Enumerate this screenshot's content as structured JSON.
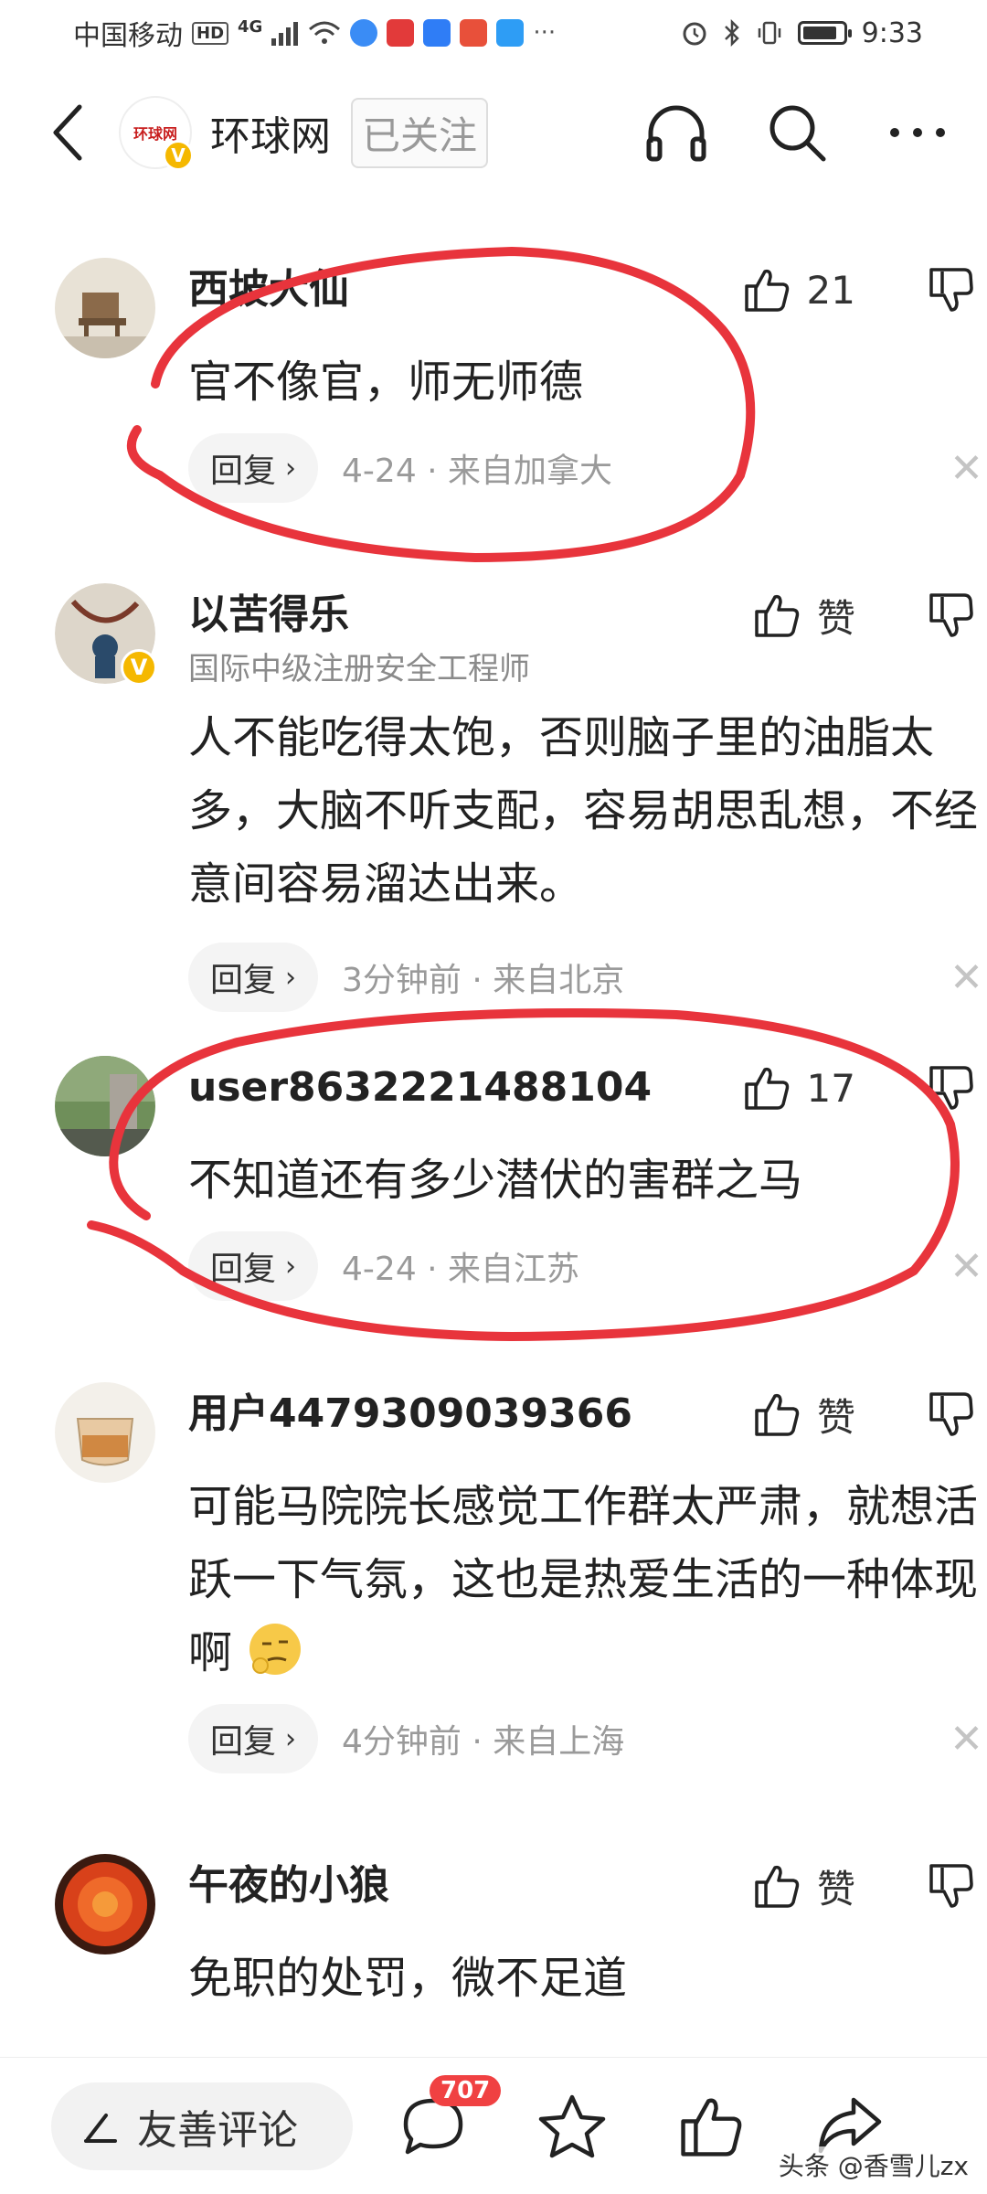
{
  "status_bar": {
    "carrier": "中国移动",
    "hd": "HD",
    "network": "4G",
    "time": "9:33",
    "battery_fraction": 0.85
  },
  "header": {
    "source_name": "环球网",
    "logo_text": "环球网",
    "verified_badge": "V",
    "follow_label": "已关注",
    "icons": [
      "back-icon",
      "headphones-icon",
      "search-icon",
      "more-icon"
    ]
  },
  "comments": [
    {
      "name": "西坡大仙",
      "subtitle": "",
      "text": "官不像官，师无师德",
      "like_label": "21",
      "reply_label": "回复",
      "meta": "4-24 · 来自加拿大"
    },
    {
      "name": "以苦得乐",
      "subtitle": "国际中级注册安全工程师",
      "text": "人不能吃得太饱，否则脑子里的油脂太多，大脑不听支配，容易胡思乱想，不经意间容易溜达出来。",
      "like_label": "赞",
      "reply_label": "回复",
      "meta": "3分钟前 · 来自北京"
    },
    {
      "name": "user8632221488104",
      "subtitle": "",
      "text": "不知道还有多少潜伏的害群之马",
      "like_label": "17",
      "reply_label": "回复",
      "meta": "4-24 · 来自江苏"
    },
    {
      "name": "用户4479309039366",
      "subtitle": "",
      "text": "可能马院院长感觉工作群太严肃，就想活跃一下气氛，这也是热爱生活的一种体现啊",
      "like_label": "赞",
      "reply_label": "回复",
      "meta": "4分钟前 · 来自上海"
    },
    {
      "name": "午夜的小狼",
      "subtitle": "",
      "text": "免职的处罚，微不足道",
      "like_label": "赞",
      "reply_label": "",
      "meta": ""
    }
  ],
  "bottom_bar": {
    "comment_placeholder": "友善评论",
    "comment_count": "707",
    "watermark": "头条 @香雪儿zx"
  },
  "colors": {
    "annotation_red": "#e8343c",
    "badge_red": "#f04142",
    "verified_gold": "#f5b800"
  }
}
